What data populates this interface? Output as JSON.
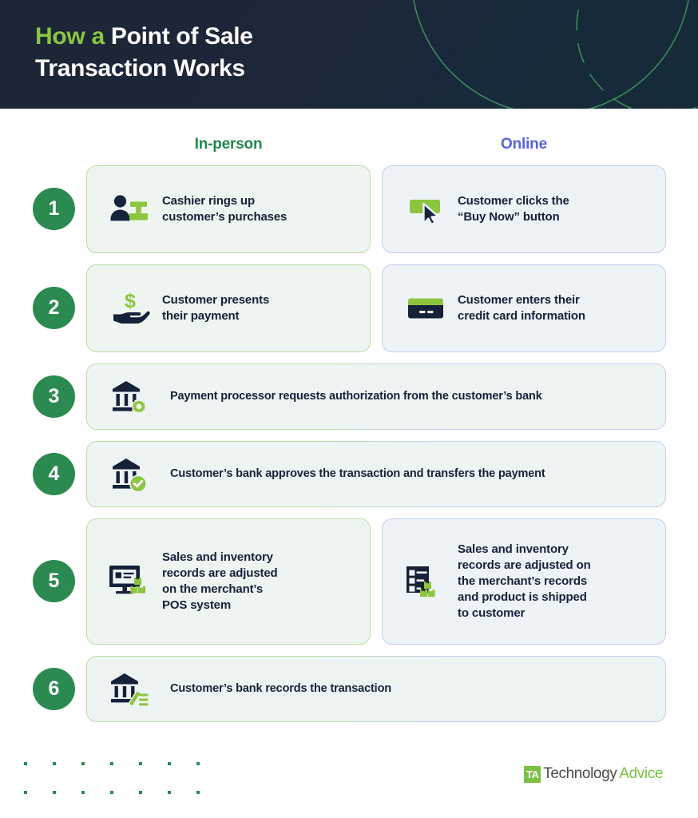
{
  "header": {
    "title_accent": "How a",
    "title_rest": " Point of Sale\nTransaction Works",
    "bg_color": "#1b2536",
    "accent_color": "#8cc63f"
  },
  "columns": {
    "in_person": {
      "label": "In-person",
      "color": "#1f8a4c"
    },
    "online": {
      "label": "Online",
      "color": "#5566d4"
    }
  },
  "steps": [
    {
      "number": "1",
      "layout": "split",
      "in_person": {
        "icon": "cashier-register-icon",
        "text": "Cashier rings up\ncustomer’s purchases"
      },
      "online": {
        "icon": "buy-now-button-cursor-icon",
        "text": "Customer clicks the\n“Buy Now” button"
      }
    },
    {
      "number": "2",
      "layout": "split",
      "in_person": {
        "icon": "hand-holding-dollar-icon",
        "text": "Customer presents\ntheir payment"
      },
      "online": {
        "icon": "credit-card-icon",
        "text": "Customer enters their\ncredit card information"
      }
    },
    {
      "number": "3",
      "layout": "wide",
      "wide": {
        "icon": "bank-gear-icon",
        "text": "Payment processor requests authorization from the customer’s bank"
      }
    },
    {
      "number": "4",
      "layout": "wide",
      "wide": {
        "icon": "bank-check-icon",
        "text": "Customer’s bank approves the transaction and transfers the payment"
      }
    },
    {
      "number": "5",
      "layout": "split",
      "in_person": {
        "icon": "pos-monitor-inventory-icon",
        "text": "Sales and inventory\nrecords are adjusted\non the merchant’s\nPOS system"
      },
      "online": {
        "icon": "records-list-inventory-icon",
        "text": "Sales and inventory\nrecords are adjusted on\nthe merchant’s records\nand product is shipped\nto customer"
      }
    },
    {
      "number": "6",
      "layout": "wide",
      "wide": {
        "icon": "bank-pencil-records-icon",
        "text": "Customer’s bank records the transaction"
      }
    }
  ],
  "footer": {
    "logo_mark": "TA",
    "logo_tech": "Technology",
    "logo_advice": "Advice",
    "dot_color": "#2a8a50",
    "dot_rows": 2,
    "dot_cols": 7
  },
  "palette": {
    "badge_green": "#2a8a50",
    "icon_dark": "#16213a",
    "icon_green": "#8cc63f",
    "card_green_border": "#b9dda0",
    "card_blue_border": "#c3cdf0",
    "card_fill": "#eef4f3"
  }
}
